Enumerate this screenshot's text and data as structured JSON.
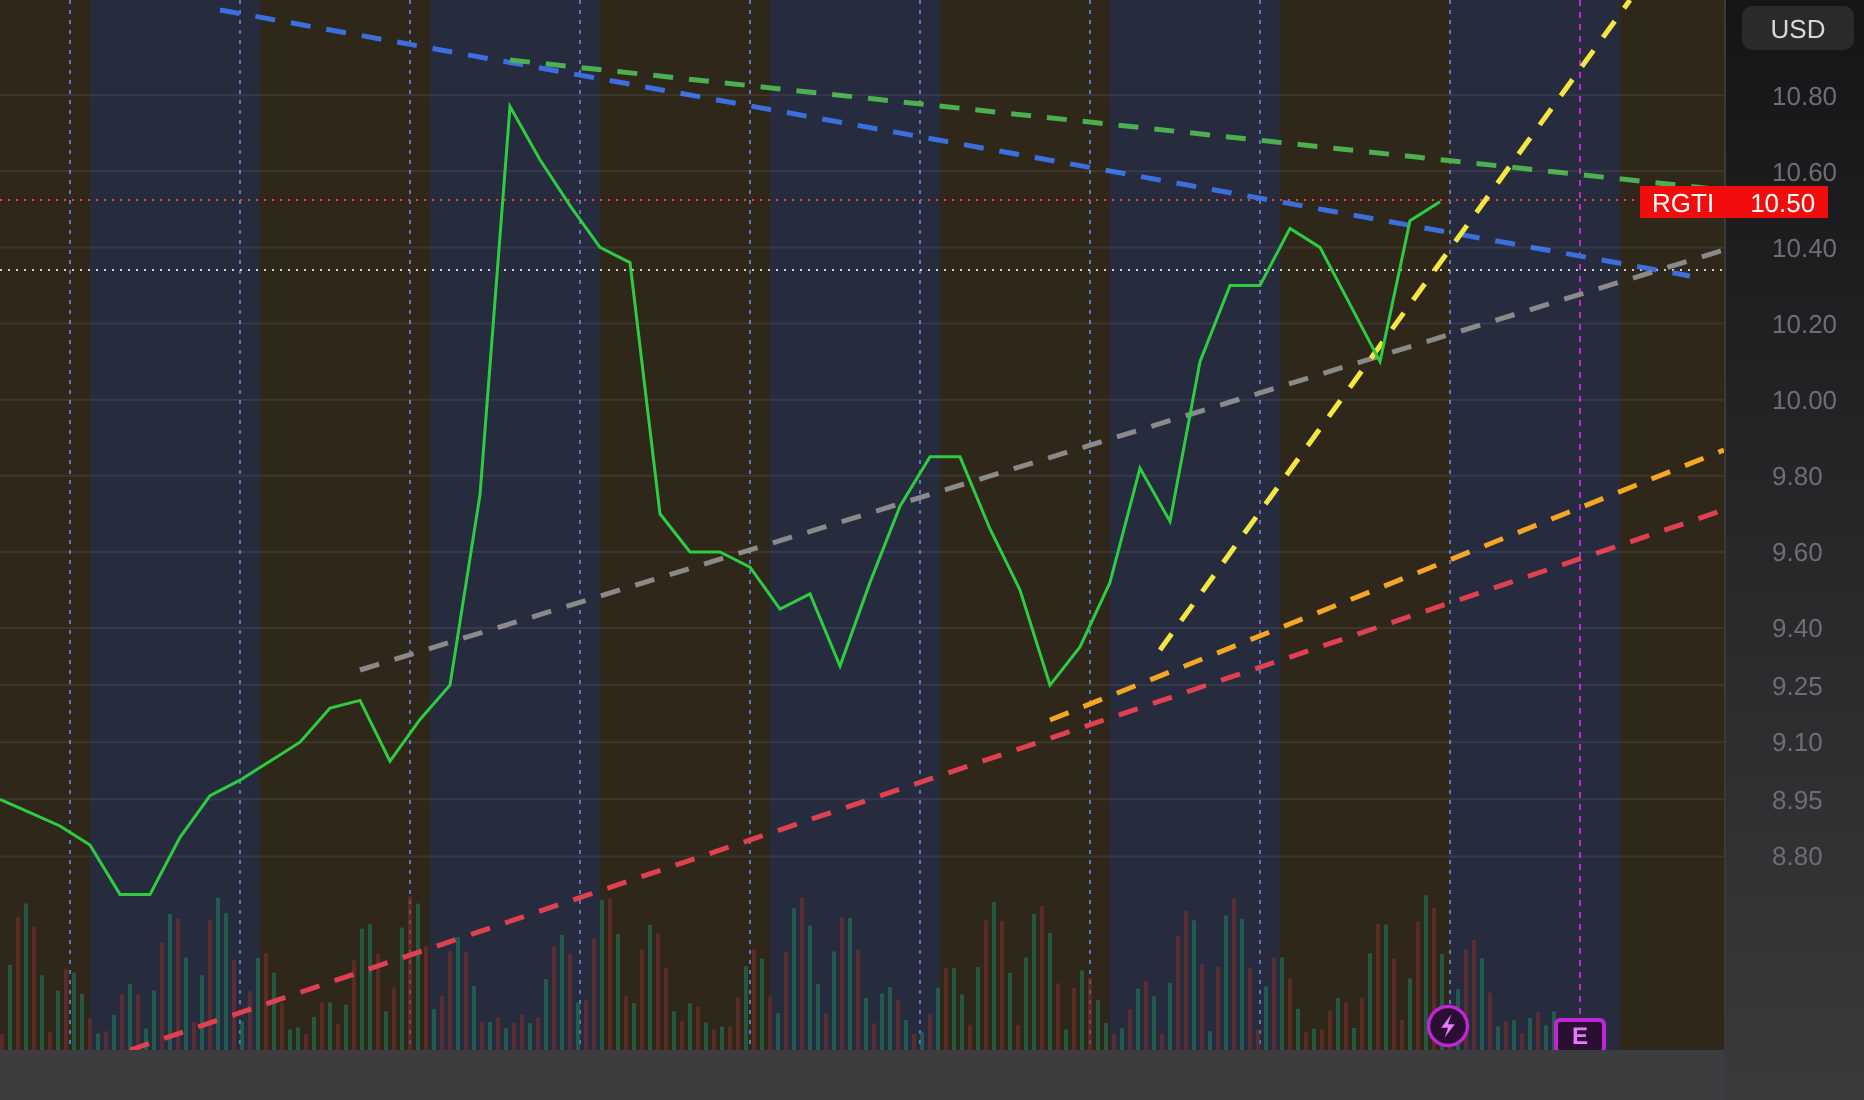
{
  "currency_button": "USD",
  "price_tag": {
    "symbol": "RGTI",
    "price": "10.50"
  },
  "markers": [
    {
      "kind": "lightning"
    },
    {
      "kind": "earnings",
      "label": "E"
    }
  ],
  "chart_data": {
    "type": "line",
    "grid": true,
    "ylim": [
      8.16,
      11.05
    ],
    "series": [
      {
        "color": "#2ecc40",
        "values": [
          8.95,
          8.915,
          8.88,
          8.83,
          8.7,
          8.7,
          8.85,
          8.96,
          9.0,
          9.05,
          9.1,
          9.19,
          9.21,
          9.05,
          9.16,
          9.25,
          9.75,
          10.77,
          10.63,
          10.51,
          10.4,
          10.36,
          9.7,
          9.6,
          9.6,
          9.56,
          9.45,
          9.49,
          9.3,
          9.52,
          9.72,
          9.85,
          9.85,
          9.66,
          9.5,
          9.25,
          9.35,
          9.52,
          9.82,
          9.68,
          10.1,
          10.3,
          10.3,
          10.45,
          10.4,
          10.25,
          10.1,
          10.47,
          10.52
        ]
      }
    ],
    "yticks": [
      {
        "value": 10.8,
        "label": "10.80"
      },
      {
        "value": 10.6,
        "label": "10.60"
      },
      {
        "value": 10.4,
        "label": "10.40"
      },
      {
        "value": 10.2,
        "label": "10.20"
      },
      {
        "value": 10.0,
        "label": "10.00"
      },
      {
        "value": 9.8,
        "label": "9.80"
      },
      {
        "value": 9.6,
        "label": "9.60"
      },
      {
        "value": 9.4,
        "label": "9.40"
      },
      {
        "value": 9.25,
        "label": "9.25"
      },
      {
        "value": 9.1,
        "label": "9.10"
      },
      {
        "value": 8.95,
        "label": "8.95"
      },
      {
        "value": 8.8,
        "label": "8.80"
      }
    ]
  }
}
